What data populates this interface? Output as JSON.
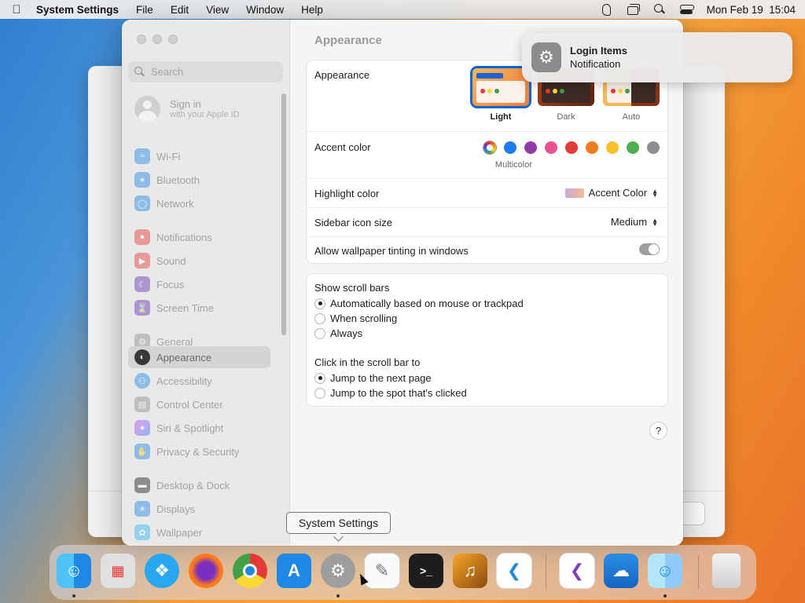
{
  "menubar": {
    "app_name": "System Settings",
    "items": [
      "File",
      "Edit",
      "View",
      "Window",
      "Help"
    ],
    "clock": "Mon Feb 19  15:04"
  },
  "sidebar": {
    "search_placeholder": "Search",
    "apple_id": {
      "line1": "Sign in",
      "line2": "with your Apple ID"
    },
    "items": [
      {
        "label": "Wi-Fi",
        "icon": "wifi-icon",
        "color": "#1e88e5"
      },
      {
        "label": "Bluetooth",
        "icon": "bluetooth-icon",
        "color": "#1e88e5"
      },
      {
        "label": "Network",
        "icon": "globe-icon",
        "color": "#1e88e5"
      },
      {
        "label": "Notifications",
        "icon": "bell-icon",
        "color": "#e53935"
      },
      {
        "label": "Sound",
        "icon": "speaker-icon",
        "color": "#e53935"
      },
      {
        "label": "Focus",
        "icon": "moon-icon",
        "color": "#5e35b1"
      },
      {
        "label": "Screen Time",
        "icon": "hourglass-icon",
        "color": "#5e35b1"
      },
      {
        "label": "General",
        "icon": "gear-icon",
        "color": "#8e8e8e"
      },
      {
        "label": "Appearance",
        "icon": "appearance-icon",
        "color": "#1d1d1f"
      },
      {
        "label": "Accessibility",
        "icon": "accessibility-icon",
        "color": "#1e88e5"
      },
      {
        "label": "Control Center",
        "icon": "control-center-icon",
        "color": "#8e8e8e"
      },
      {
        "label": "Siri & Spotlight",
        "icon": "siri-icon",
        "color": "#c04ad0"
      },
      {
        "label": "Privacy & Security",
        "icon": "hand-icon",
        "color": "#1e88e5"
      },
      {
        "label": "Desktop & Dock",
        "icon": "dock-icon",
        "color": "#1d1d1f"
      },
      {
        "label": "Displays",
        "icon": "sun-icon",
        "color": "#1e88e5"
      },
      {
        "label": "Wallpaper",
        "icon": "wallpaper-icon",
        "color": "#29b6f6"
      }
    ],
    "selected": "Appearance"
  },
  "content": {
    "title": "Appearance",
    "appearance_label": "Appearance",
    "themes": [
      {
        "name": "Light",
        "active": true
      },
      {
        "name": "Dark",
        "active": false
      },
      {
        "name": "Auto",
        "active": false
      }
    ],
    "accent_label": "Accent color",
    "accent_colors": [
      "multicolor",
      "#1e7cf0",
      "#8e3ea6",
      "#e8508f",
      "#e53935",
      "#f07c1d",
      "#f6c12a",
      "#4caf50",
      "#8e8e8e"
    ],
    "accent_selected_label": "Multicolor",
    "highlight_label": "Highlight color",
    "highlight_value": "Accent Color",
    "icon_size_label": "Sidebar icon size",
    "icon_size_value": "Medium",
    "tinting_label": "Allow wallpaper tinting in windows",
    "tinting_on": false,
    "scroll_title": "Show scroll bars",
    "scroll_options": [
      {
        "label": "Automatically based on mouse or trackpad",
        "checked": true
      },
      {
        "label": "When scrolling",
        "checked": false
      },
      {
        "label": "Always",
        "checked": false
      }
    ],
    "click_title": "Click in the scroll bar to",
    "click_options": [
      {
        "label": "Jump to the next page",
        "checked": true
      },
      {
        "label": "Jump to the spot that's clicked",
        "checked": false
      }
    ],
    "help": "?"
  },
  "background_window": {
    "button_label": "ue"
  },
  "notification": {
    "title": "Login Items",
    "body": "Notification"
  },
  "tooltip": "System Settings",
  "dock": {
    "apps": [
      "Finder",
      "Launchpad",
      "Safari",
      "Firefox",
      "Chrome",
      "App Store",
      "System Settings",
      "TextEdit",
      "Terminal",
      "GarageBand",
      "VS Code",
      "Visual Studio",
      "Weather",
      "Finder Documents",
      "Trash"
    ]
  }
}
